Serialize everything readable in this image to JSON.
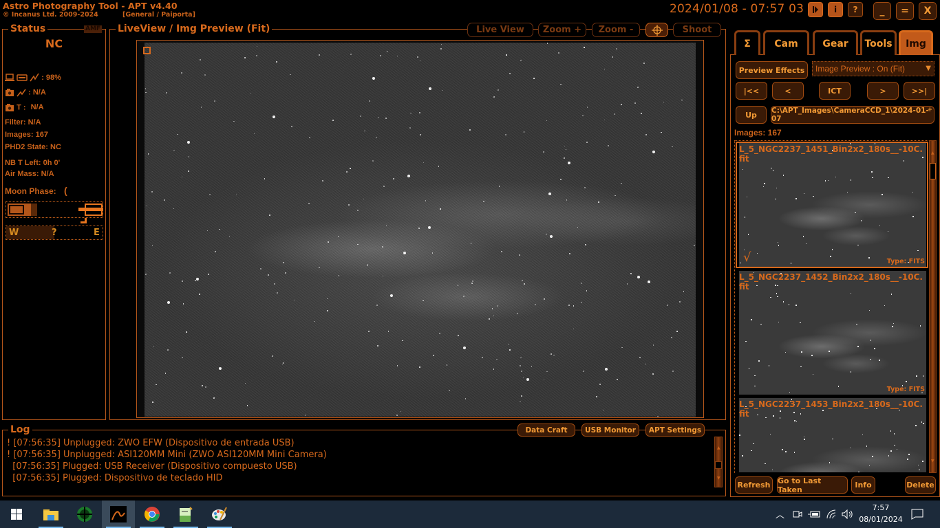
{
  "titlebar": {
    "title": "Astro Photography Tool  -  APT v4.40",
    "copyright": "© Incanus Ltd. 2009-2024",
    "profile": "[General / Paiporta]",
    "datetime": "2024/01/08 - 07:57 03",
    "buttons": {
      "play": "▶",
      "info": "i",
      "help": "?",
      "minimize": "_",
      "maximize": "=",
      "close": "X"
    }
  },
  "status": {
    "title": "Status",
    "badge": "AMF",
    "connection": "NC",
    "battery": ": 98%",
    "cam_power": ": N/A",
    "cam_temp_label": "T :",
    "cam_temp": "N/A",
    "filter": "Filter: N/A",
    "images": "Images: 167",
    "phd2": "PHD2 State: NC",
    "nb_time_left": "NB T Left: 0h 0'",
    "air_mass": "Air Mass: N/A",
    "moon_phase_label": "Moon Phase:",
    "moon_phase_glyph": "(",
    "compass": {
      "w": "W",
      "mid": "?",
      "e": "E"
    }
  },
  "liveview": {
    "title": "LiveView / Img Preview (Fit)",
    "toolbar": {
      "live_view": "Live View",
      "zoom_in": "Zoom +",
      "zoom_out": "Zoom -",
      "shoot": "Shoot"
    }
  },
  "log": {
    "title": "Log",
    "buttons": {
      "data_craft": "Data Craft",
      "usb_monitor": "USB Monitor",
      "apt_settings": "APT Settings"
    },
    "lines": [
      {
        "mark": "!",
        "text": "[07:56:35] Unplugged: ZWO EFW (Dispositivo de entrada USB)"
      },
      {
        "mark": "!",
        "text": "[07:56:35] Unplugged: ASI120MM Mini (ZWO ASI120MM Mini Camera)"
      },
      {
        "mark": " ",
        "text": "[07:56:35] Plugged: USB Receiver (Dispositivo compuesto USB)"
      },
      {
        "mark": " ",
        "text": "[07:56:35] Plugged: Dispositivo de teclado HID"
      }
    ]
  },
  "right_panel": {
    "tabs": [
      {
        "label": "Σ",
        "active": false
      },
      {
        "label": "Cam",
        "active": false
      },
      {
        "label": "Gear",
        "active": false
      },
      {
        "label": "Tools",
        "active": false
      },
      {
        "label": "Img",
        "active": true
      }
    ],
    "preview_effects": "Preview Effects",
    "image_preview_select": "Image Preview : On (Fit)",
    "nav": {
      "first": "|<<",
      "prev": "<",
      "ict": "ICT",
      "next": ">",
      "last": ">>|"
    },
    "up": "Up",
    "path": "C:\\APT_Images\\CameraCCD_1\\2024-01-07",
    "images_count": "Images: 167",
    "thumbnails": [
      {
        "name": "L_5_NGC2237_1451_Bin2x2_180s__-10C.fit",
        "type": "Type: FITS",
        "selected": true,
        "check": "√"
      },
      {
        "name": "L_5_NGC2237_1452_Bin2x2_180s__-10C.fit",
        "type": "Type: FITS",
        "selected": false
      },
      {
        "name": "L_5_NGC2237_1453_Bin2x2_180s__-10C.fit",
        "type": "",
        "selected": false
      }
    ],
    "bottom_buttons": {
      "refresh": "Refresh",
      "go_last": "Go to Last Taken",
      "info": "Info",
      "delete": "Delete"
    }
  },
  "taskbar": {
    "apps": [
      "start",
      "file-explorer",
      "phd2",
      "apt",
      "chrome",
      "notepad-plus",
      "paint"
    ],
    "clock_time": "7:57",
    "clock_date": "08/01/2024"
  },
  "colors": {
    "accent": "#d7691c",
    "accent_bright": "#f29a35",
    "button_bg": "#3a1a06",
    "taskbar": "#1c2a3a"
  }
}
